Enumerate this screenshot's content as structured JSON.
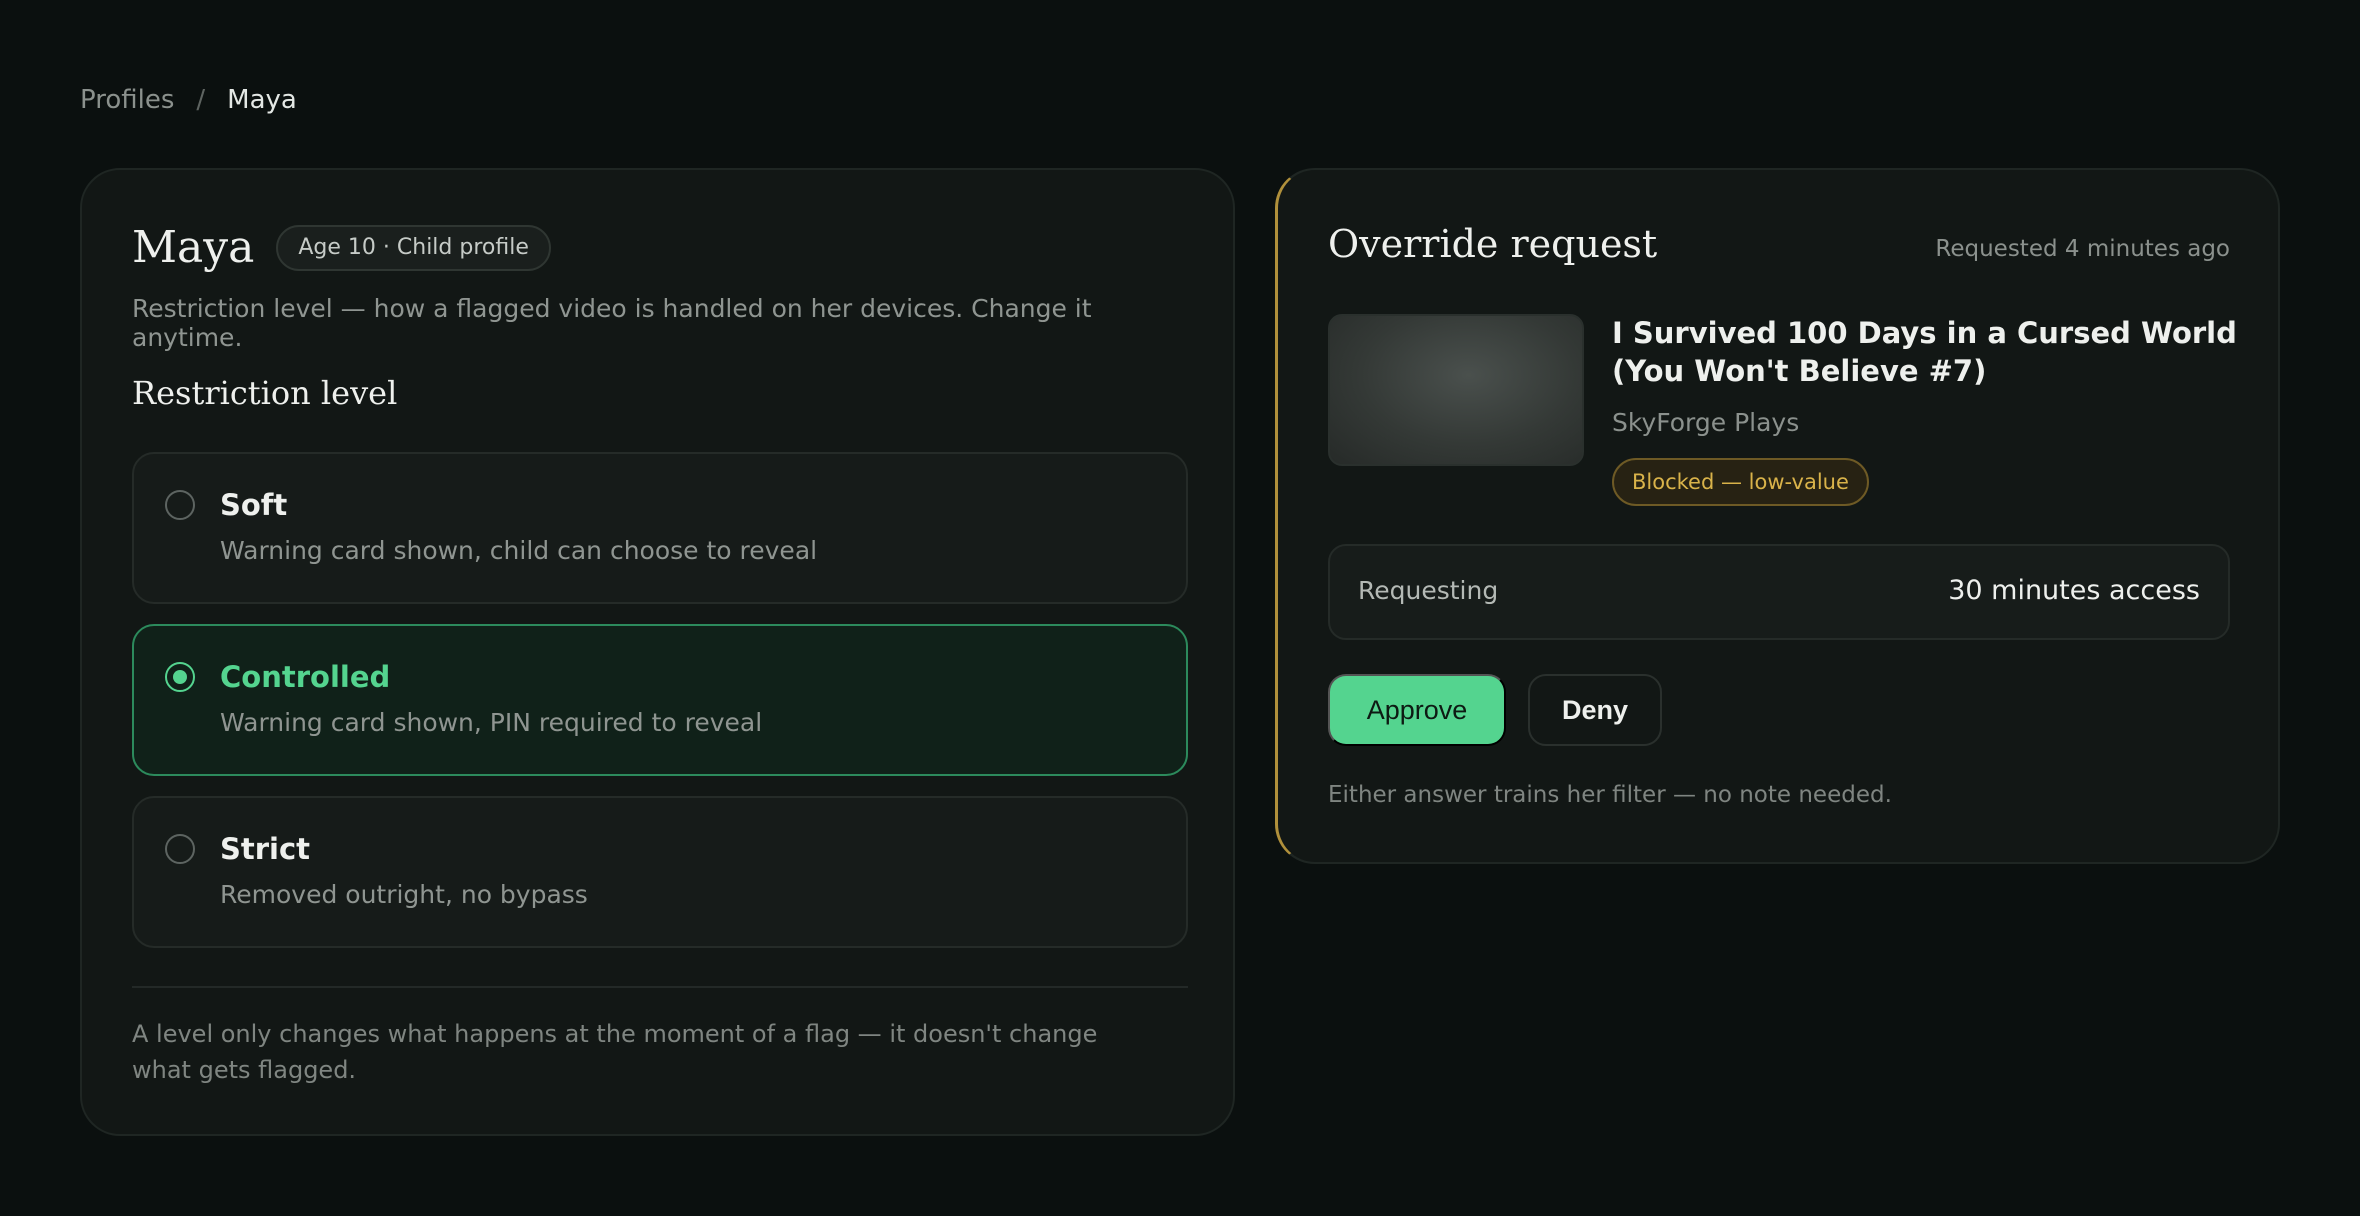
{
  "breadcrumb": {
    "parent": "Profiles",
    "separator": "/",
    "current": "Maya"
  },
  "profile": {
    "name": "Maya",
    "badge": "Age 10 · Child profile",
    "description": "Restriction level — how a flagged video is handled on her devices. Change it anytime."
  },
  "restriction": {
    "section_title": "Restriction level",
    "selected": "Controlled",
    "options": [
      {
        "title": "Soft",
        "description": "Warning card shown, child can choose to reveal"
      },
      {
        "title": "Controlled",
        "description": "Warning card shown, PIN required to reveal"
      },
      {
        "title": "Strict",
        "description": "Removed outright, no bypass"
      }
    ],
    "footnote": "A level only changes what happens at the moment of a flag — it doesn't change what gets flagged."
  },
  "override_request": {
    "title": "Override request",
    "requested_time": "Requested 4 minutes ago",
    "video": {
      "title": "I Survived 100 Days in a Cursed World (You Won't Believe #7)",
      "channel": "SkyForge Plays",
      "status_badge": "Blocked — low-value"
    },
    "requesting_label": "Requesting",
    "requesting_value": "30 minutes access",
    "approve_label": "Approve",
    "deny_label": "Deny",
    "hint": "Either answer trains her filter — no note needed."
  },
  "colors": {
    "background": "#0b100f",
    "card": "#121715",
    "accent_green": "#54d48f",
    "accent_amber": "#d9b34a",
    "request_border": "#b0903b"
  }
}
